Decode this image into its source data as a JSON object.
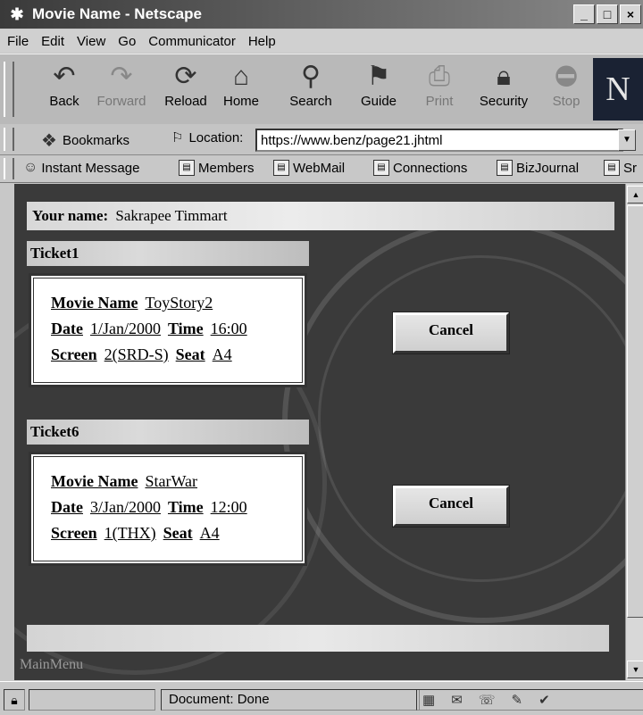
{
  "window": {
    "title": "Movie Name - Netscape",
    "controls": [
      "_",
      "□",
      "×"
    ]
  },
  "menu": [
    "File",
    "Edit",
    "View",
    "Go",
    "Communicator",
    "Help"
  ],
  "toolbar": {
    "buttons": [
      {
        "label": "Back",
        "icon": "back-arrow-icon",
        "enabled": true
      },
      {
        "label": "Forward",
        "icon": "forward-arrow-icon",
        "enabled": false
      },
      {
        "label": "Reload",
        "icon": "reload-icon",
        "enabled": true
      },
      {
        "label": "Home",
        "icon": "home-icon",
        "enabled": true
      },
      {
        "label": "Search",
        "icon": "search-icon",
        "enabled": true
      },
      {
        "label": "Guide",
        "icon": "guide-icon",
        "enabled": true
      },
      {
        "label": "Print",
        "icon": "print-icon",
        "enabled": false
      },
      {
        "label": "Security",
        "icon": "lock-icon",
        "enabled": true
      },
      {
        "label": "Stop",
        "icon": "stop-icon",
        "enabled": false
      }
    ],
    "logo": "N"
  },
  "location": {
    "bookmarks_label": "Bookmarks",
    "location_label": "Location:",
    "url": "https://www.benz/page21.jhtml"
  },
  "personal_toolbar": [
    "Instant Message",
    "Members",
    "WebMail",
    "Connections",
    "BizJournal",
    "Sr"
  ],
  "page": {
    "name_label": "Your name:",
    "name_value": "Sakrapee Timmart",
    "tickets": [
      {
        "header": "Ticket1",
        "movie_label": "Movie Name",
        "movie": "ToyStory2",
        "date_label": "Date",
        "date": "1/Jan/2000",
        "time_label": "Time",
        "time": "16:00",
        "screen_label": "Screen",
        "screen": "2(SRD-S)",
        "seat_label": "Seat",
        "seat": "A4",
        "cancel_label": "Cancel"
      },
      {
        "header": "Ticket6",
        "movie_label": "Movie Name",
        "movie": "StarWar",
        "date_label": "Date",
        "date": "3/Jan/2000",
        "time_label": "Time",
        "time": "12:00",
        "screen_label": "Screen",
        "screen": "1(THX)",
        "seat_label": "Seat",
        "seat": "A4",
        "cancel_label": "Cancel"
      }
    ],
    "main_menu": "MainMenu"
  },
  "status": {
    "text": "Document: Done"
  }
}
